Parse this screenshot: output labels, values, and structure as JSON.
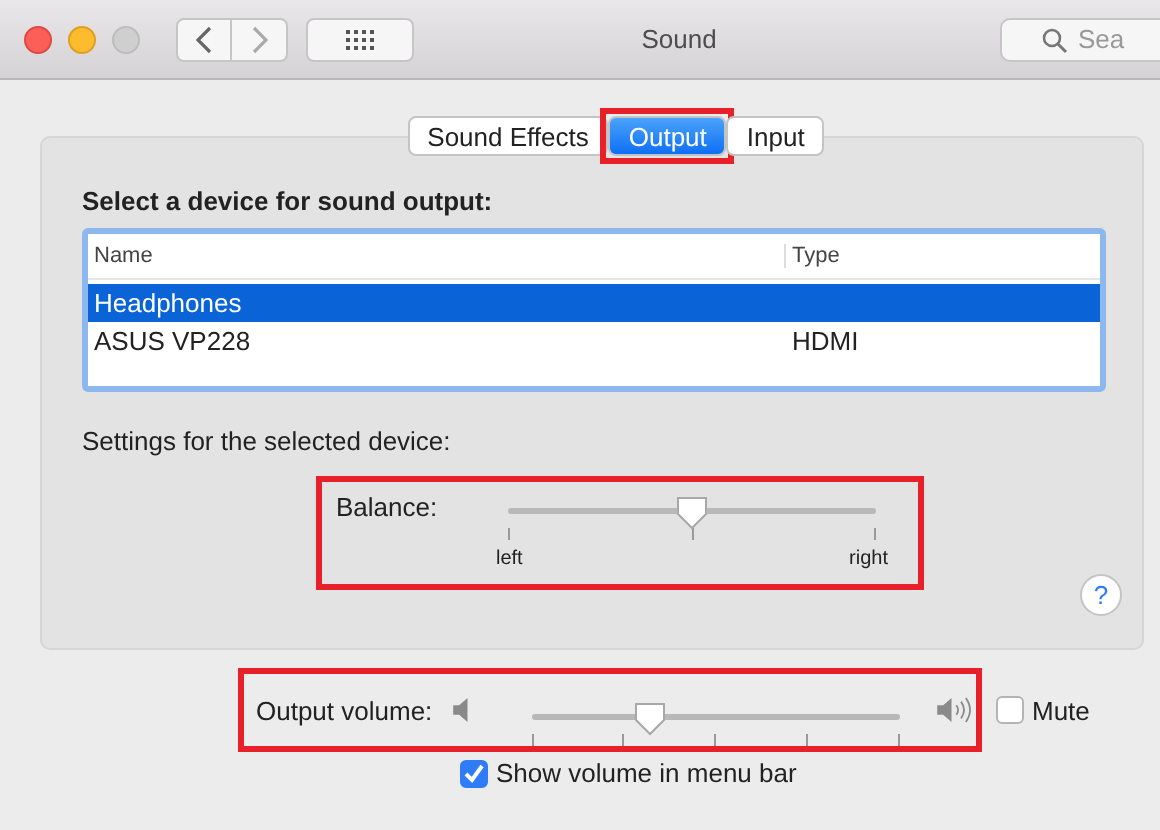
{
  "window": {
    "title": "Sound"
  },
  "search": {
    "placeholder": "Sea"
  },
  "tabs": [
    {
      "label": "Sound Effects",
      "selected": false,
      "highlighted": false
    },
    {
      "label": "Output",
      "selected": true,
      "highlighted": true
    },
    {
      "label": "Input",
      "selected": false,
      "highlighted": false
    }
  ],
  "heading": "Select a device for sound output:",
  "table": {
    "columns": [
      "Name",
      "Type"
    ],
    "rows": [
      {
        "name": "Headphones",
        "selected": true
      },
      {
        "name": "ASUS VP228",
        "type": "HDMI",
        "selected": false
      }
    ]
  },
  "settings_label": "Settings for the selected device:",
  "balance": {
    "label": "Balance:",
    "level": 0.5,
    "min_label": "left",
    "max_label": "right",
    "highlighted": true
  },
  "help": "?",
  "output_volume": {
    "label": "Output volume:",
    "level": 0.32,
    "highlighted": true
  },
  "mute": {
    "label": "Mute",
    "checked": false
  },
  "show_volume": {
    "label": "Show volume in menu bar",
    "checked": true
  }
}
